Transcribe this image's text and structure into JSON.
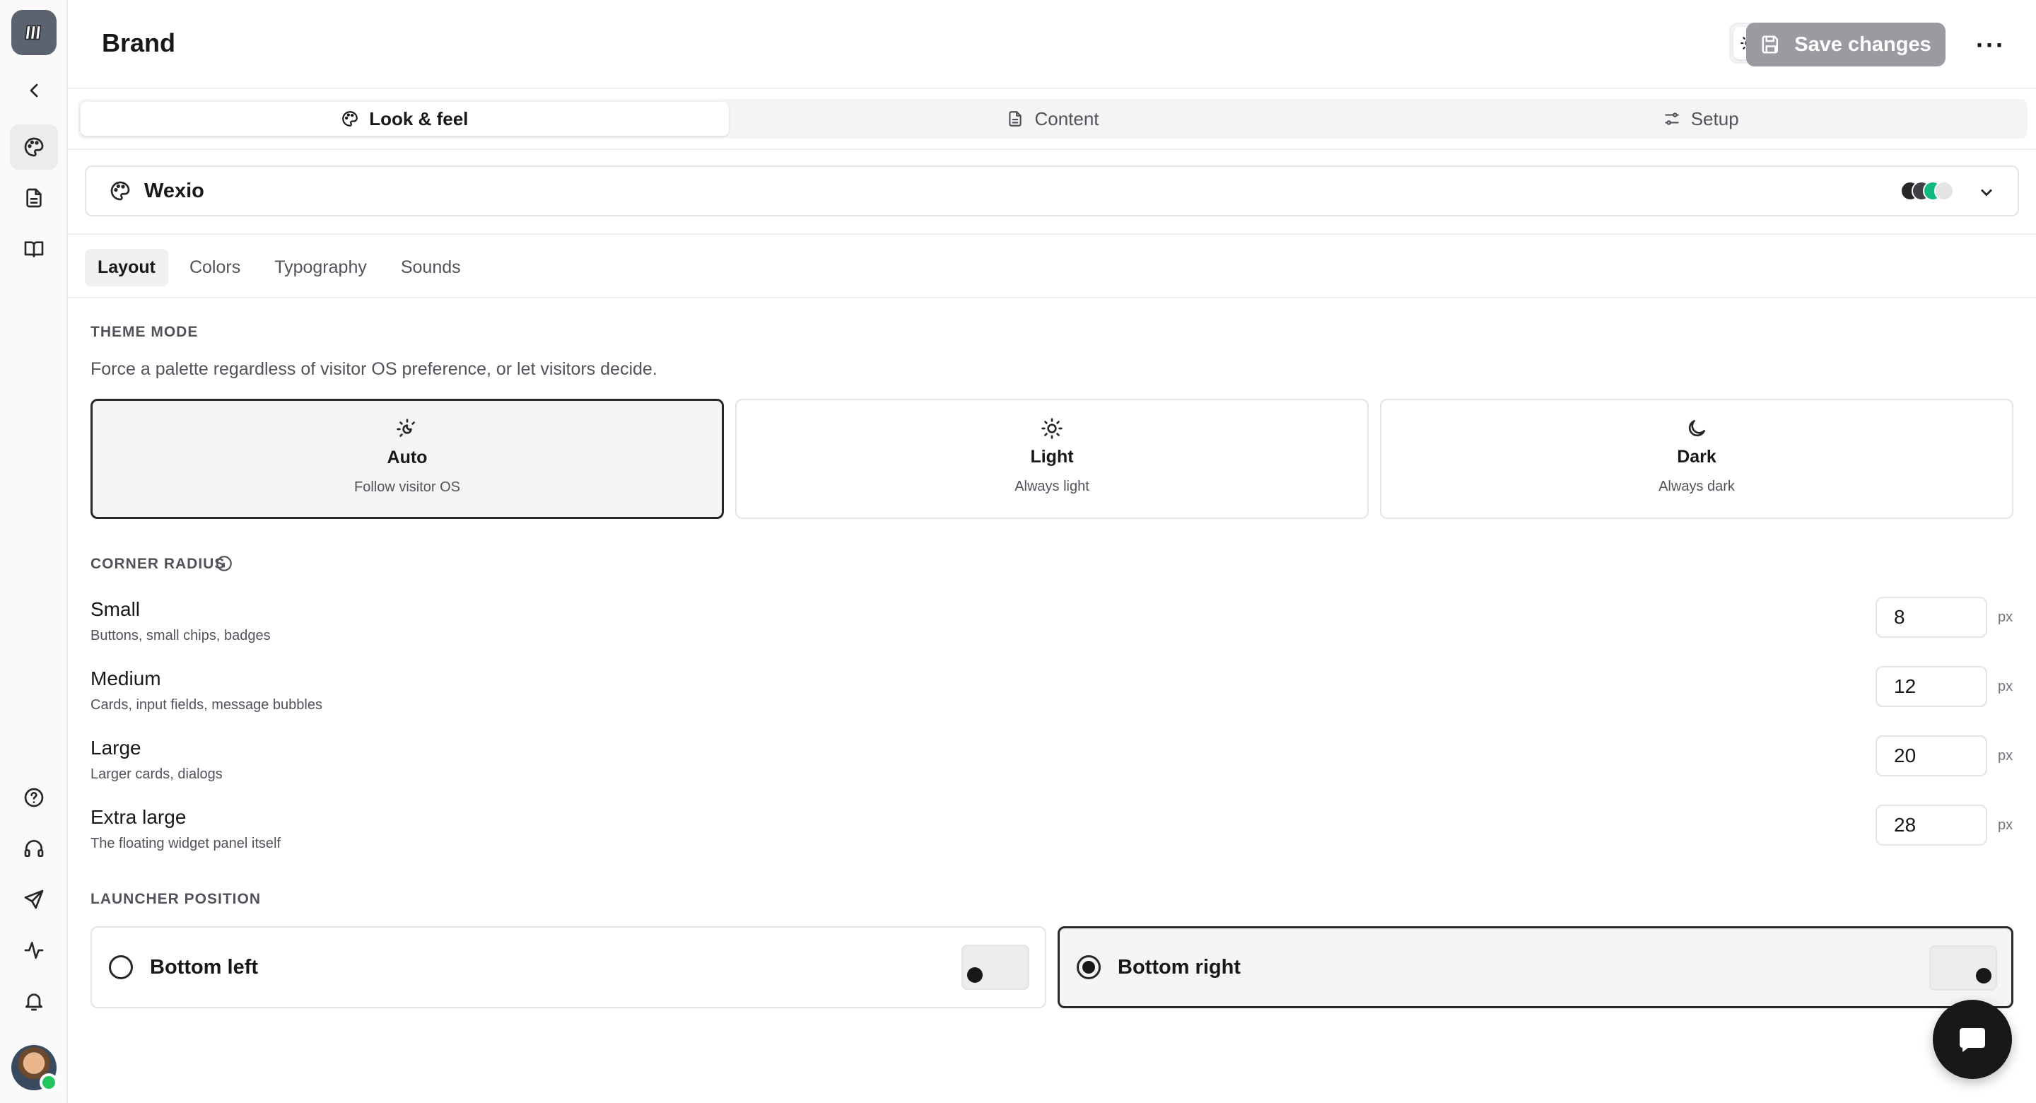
{
  "header": {
    "title": "Brand",
    "save_label": "Save changes",
    "more_label": "···"
  },
  "top_tabs": [
    {
      "label": "Look & feel",
      "icon": "palette-icon",
      "active": true
    },
    {
      "label": "Content",
      "icon": "document-icon",
      "active": false
    },
    {
      "label": "Setup",
      "icon": "sliders-icon",
      "active": false
    }
  ],
  "palette": {
    "name": "Wexio",
    "swatch_colors": [
      "#27272a",
      "#3f3f46",
      "#10b981",
      "#e4e4e7"
    ]
  },
  "sub_tabs": [
    {
      "label": "Layout",
      "active": true
    },
    {
      "label": "Colors",
      "active": false
    },
    {
      "label": "Typography",
      "active": false
    },
    {
      "label": "Sounds",
      "active": false
    }
  ],
  "theme_mode": {
    "section_label": "THEME MODE",
    "description": "Force a palette regardless of visitor OS preference, or let visitors decide.",
    "options": [
      {
        "title": "Auto",
        "subtitle": "Follow visitor OS",
        "selected": true
      },
      {
        "title": "Light",
        "subtitle": "Always light",
        "selected": false
      },
      {
        "title": "Dark",
        "subtitle": "Always dark",
        "selected": false
      }
    ]
  },
  "corner_radius": {
    "section_label": "CORNER RADIUS",
    "unit": "px",
    "rows": [
      {
        "label": "Small",
        "sublabel": "Buttons, small chips, badges",
        "value": "8"
      },
      {
        "label": "Medium",
        "sublabel": "Cards, input fields, message bubbles",
        "value": "12"
      },
      {
        "label": "Large",
        "sublabel": "Larger cards, dialogs",
        "value": "20"
      },
      {
        "label": "Extra large",
        "sublabel": "The floating widget panel itself",
        "value": "28"
      }
    ]
  },
  "launcher": {
    "section_label": "LAUNCHER POSITION",
    "options": [
      {
        "label": "Bottom left",
        "selected": false
      },
      {
        "label": "Bottom right",
        "selected": true
      }
    ]
  },
  "colors": {
    "accent_dark": "#18181b",
    "online": "#22c55e",
    "save_button_disabled": "#9a9aa0"
  }
}
